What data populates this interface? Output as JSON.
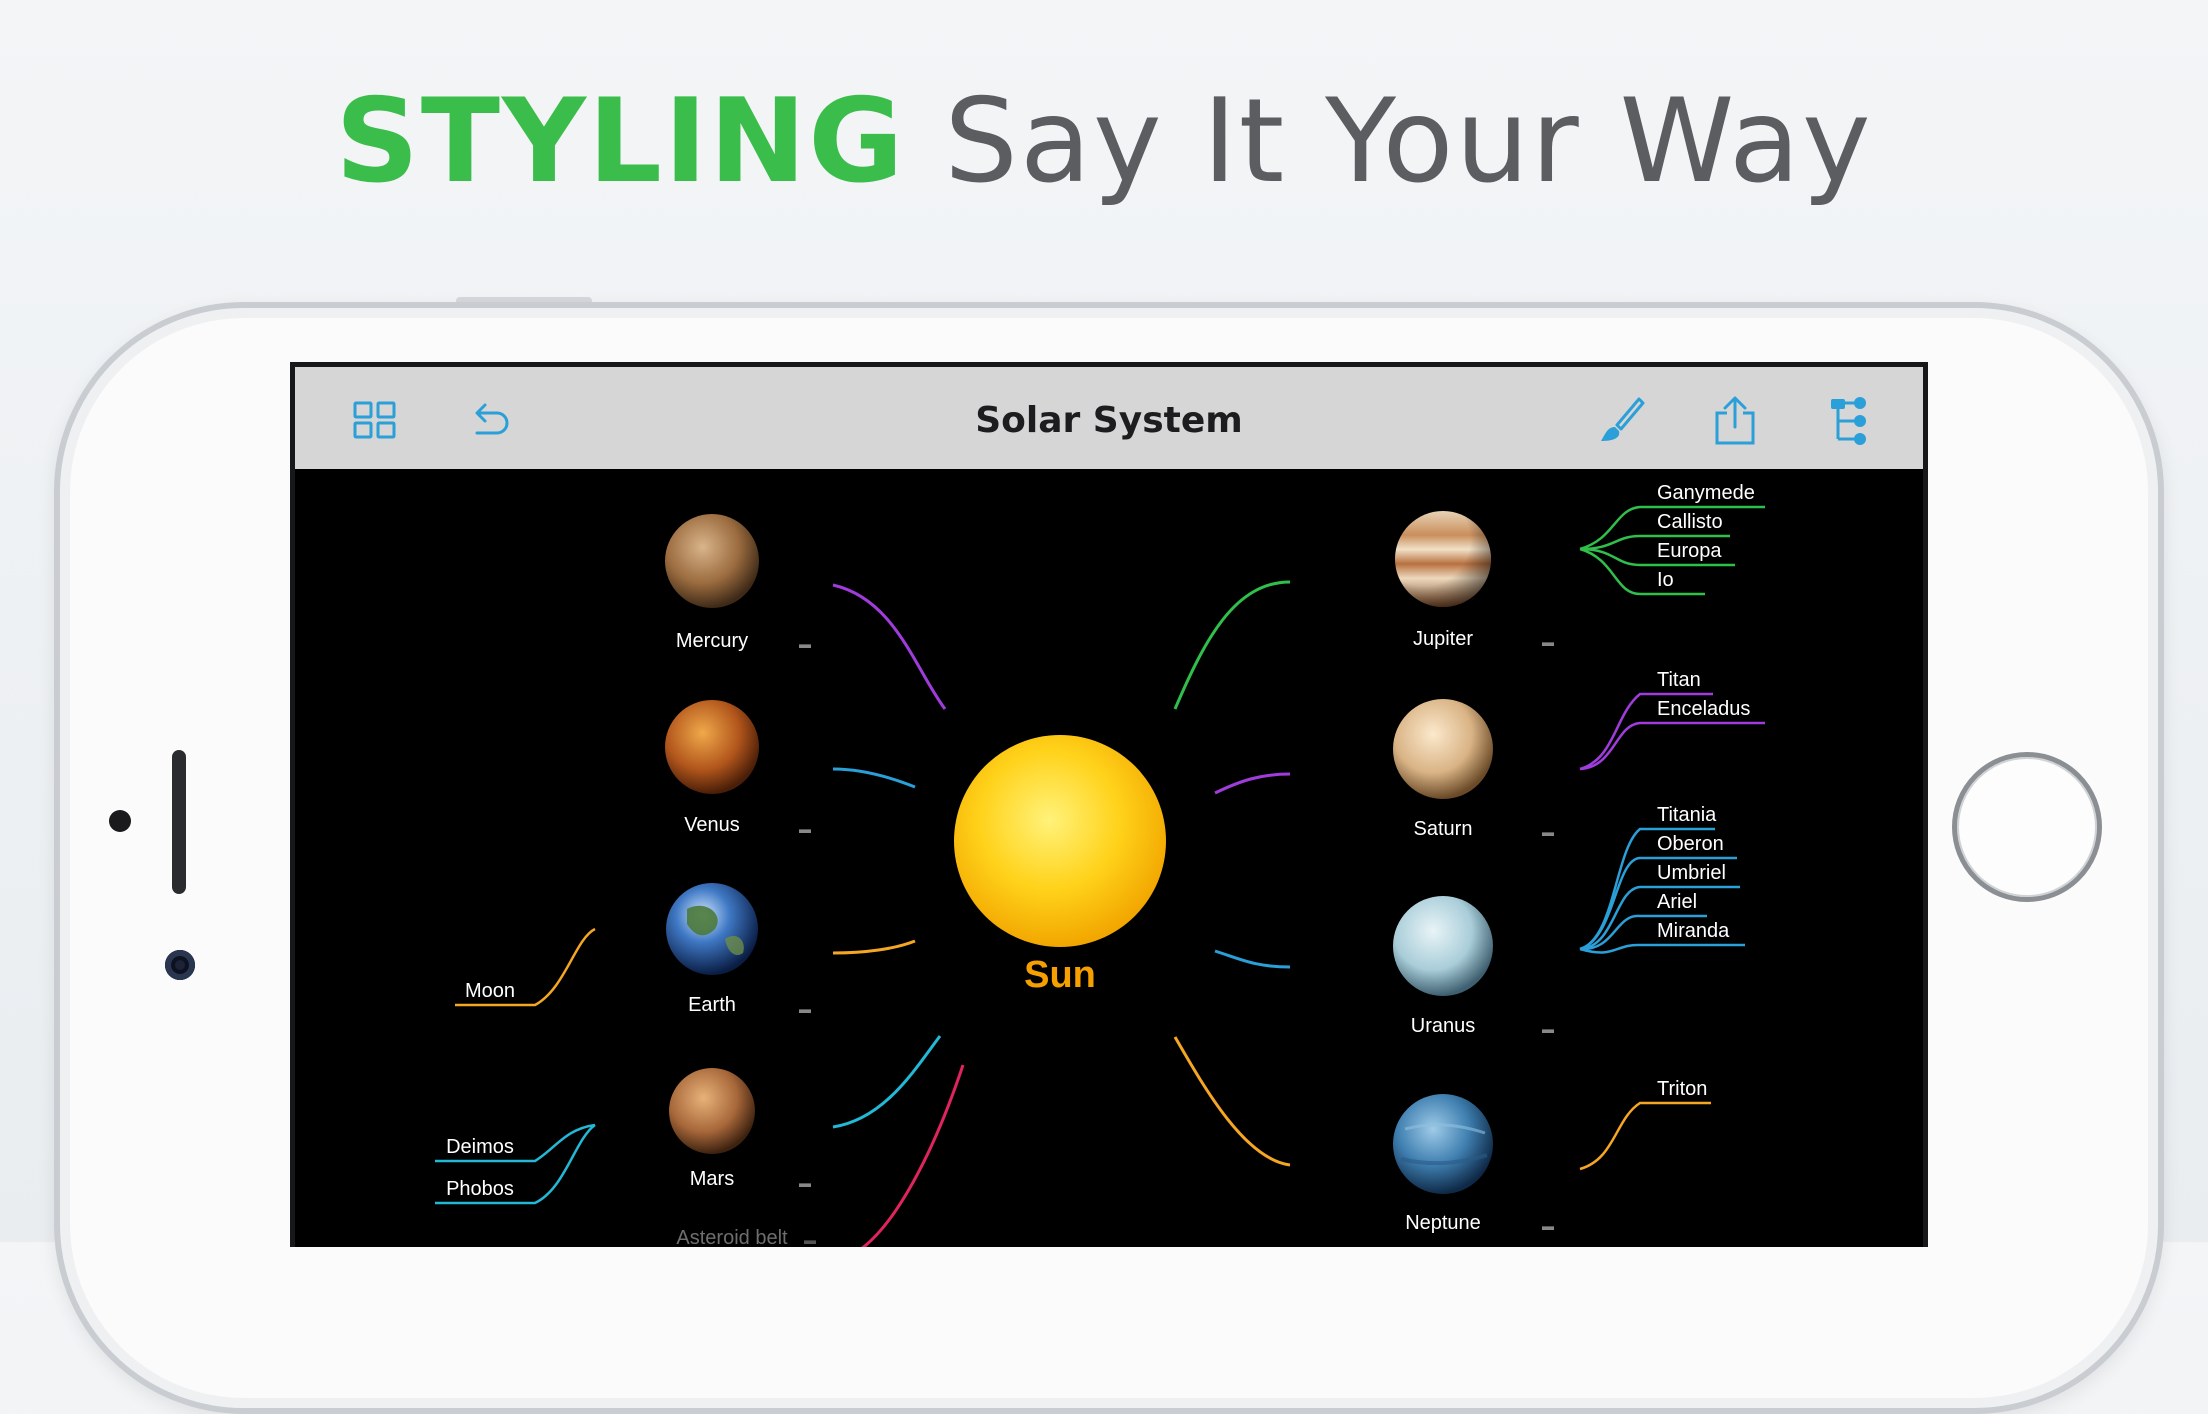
{
  "headline": {
    "accent": "STYLING",
    "rest": "Say It Your Way"
  },
  "app": {
    "title": "Solar System",
    "toolbar_icons": [
      "grid-icon",
      "undo-icon",
      "brush-icon",
      "share-icon",
      "outline-tree-icon"
    ]
  },
  "mindmap": {
    "center": {
      "label": "Sun",
      "color": "#f5a000"
    },
    "planets": {
      "mercury": {
        "label": "Mercury",
        "branch_color": "#a13cdc"
      },
      "venus": {
        "label": "Venus",
        "branch_color": "#2a9fd8"
      },
      "earth": {
        "label": "Earth",
        "branch_color": "#f5a623",
        "moons": [
          "Moon"
        ]
      },
      "mars": {
        "label": "Mars",
        "branch_color": "#22b8d6",
        "moons": [
          "Deimos",
          "Phobos"
        ]
      },
      "asteroid_belt": {
        "label": "Asteroid belt",
        "branch_color": "#e0245e"
      },
      "jupiter": {
        "label": "Jupiter",
        "branch_color": "#2fbf4a",
        "moons": [
          "Ganymede",
          "Callisto",
          "Europa",
          "Io"
        ]
      },
      "saturn": {
        "label": "Saturn",
        "branch_color": "#a13cdc",
        "moons": [
          "Titan",
          "Enceladus"
        ]
      },
      "uranus": {
        "label": "Uranus",
        "branch_color": "#2a9fd8",
        "moons": [
          "Titania",
          "Oberon",
          "Umbriel",
          "Ariel",
          "Miranda"
        ]
      },
      "neptune": {
        "label": "Neptune",
        "branch_color": "#f5a623",
        "moons": [
          "Triton"
        ]
      }
    }
  }
}
